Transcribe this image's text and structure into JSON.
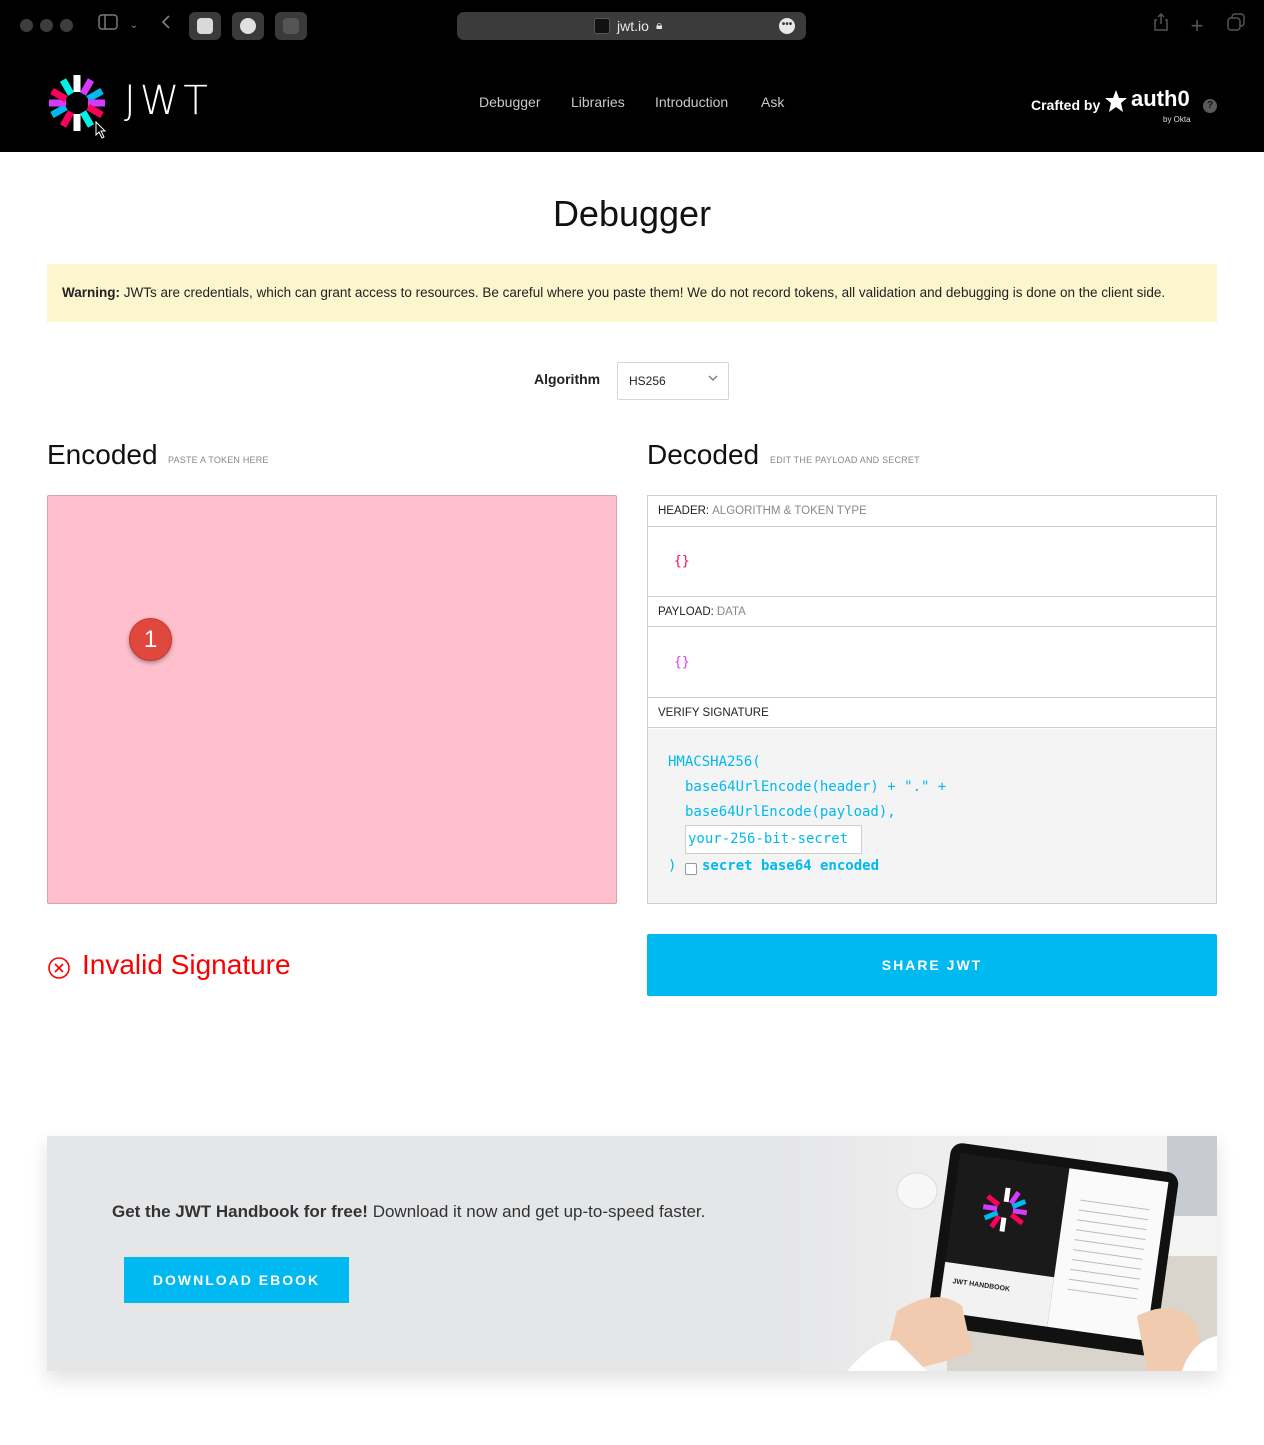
{
  "browser": {
    "url": "jwt.io"
  },
  "header": {
    "logo_text": "JWT",
    "nav": [
      "Debugger",
      "Libraries",
      "Introduction",
      "Ask"
    ],
    "crafted_by": "Crafted by",
    "partner": "auth0",
    "partner_sub": "by Okta",
    "help": "?"
  },
  "main": {
    "title": "Debugger",
    "warning_label": "Warning:",
    "warning_text": "JWTs are credentials, which can grant access to resources. Be careful where you paste them! We do not record tokens, all validation and debugging is done on the client side.",
    "algorithm_label": "Algorithm",
    "algorithm_value": "HS256",
    "encoded_title": "Encoded",
    "encoded_sub": "PASTE A TOKEN HERE",
    "decoded_title": "Decoded",
    "decoded_sub": "EDIT THE PAYLOAD AND SECRET",
    "marker": "1",
    "header_label": "HEADER:",
    "header_sub": "ALGORITHM & TOKEN TYPE",
    "header_json": "{}",
    "payload_label": "PAYLOAD:",
    "payload_sub": "DATA",
    "payload_json": "{}",
    "verify_label": "VERIFY SIGNATURE",
    "sig_line1": "HMACSHA256(",
    "sig_line2": "base64UrlEncode(header) + \".\" +",
    "sig_line3": "base64UrlEncode(payload),",
    "secret_placeholder": "your-256-bit-secret",
    "sig_close": ")",
    "secret_b64": "secret base64 encoded",
    "status": "Invalid Signature",
    "share": "SHARE JWT"
  },
  "handbook": {
    "title": "Get the JWT Handbook for free!",
    "text": "Download it now and get up-to-speed faster.",
    "button": "DOWNLOAD EBOOK",
    "book_title": "JWT HANDBOOK"
  },
  "colors": {
    "accent": "#00b9f1",
    "error": "#fb0000",
    "encoded_bg": "#ffbfcc",
    "warning_bg": "#fcf6cf"
  }
}
